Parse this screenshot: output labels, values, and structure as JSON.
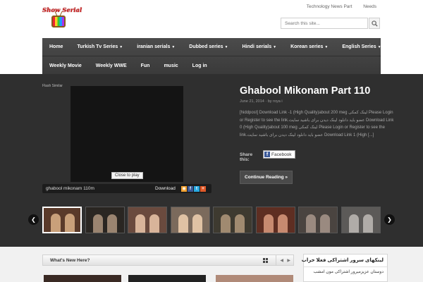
{
  "header": {
    "logo_text": "Show Serial",
    "top_links": [
      "Technology News Part",
      "Needs"
    ],
    "search_placeholder": "Search this site..."
  },
  "nav": {
    "row1": [
      {
        "label": "Home",
        "dropdown": false
      },
      {
        "label": "Turkish Tv Series",
        "dropdown": true
      },
      {
        "label": "iranian serials",
        "dropdown": true
      },
      {
        "label": "Dubbed series",
        "dropdown": true
      },
      {
        "label": "Hindi serials",
        "dropdown": true
      },
      {
        "label": "Korean series",
        "dropdown": true
      },
      {
        "label": "English Series",
        "dropdown": true
      }
    ],
    "row2": [
      {
        "label": "Weekly Movie",
        "dropdown": false
      },
      {
        "label": "Weekly WWE",
        "dropdown": false
      },
      {
        "label": "Fun",
        "dropdown": false
      },
      {
        "label": "music",
        "dropdown": false
      },
      {
        "label": "Log in",
        "dropdown": false
      }
    ]
  },
  "featured": {
    "video_top_label": "Flash Similar",
    "close_button": "Close to play",
    "video_title": "ghabool mikonam 110m",
    "download_label": "Download",
    "title": "Ghabool Mikonam Part 110",
    "meta": "June 21, 2014 · by roya i",
    "excerpt": "[hiddpost] Download Link -1 (High Quality)about 200 meg لینک کمکی Please Login or Register to see the link.عضو باید دانلود لینک دیدن برای باشید سایت Download Link 0 (High Quality)about 100 meg لینک کمکی Please Login or Register to see the link.عضو باید دانلود لینک دیدن برای باشید سایت Download Link 1 (High [...]",
    "share_label": "Share this:",
    "facebook_label": "Facebook",
    "continue_label": "Continue Reading »"
  },
  "carousel": {
    "prev_icon": "chevron-left-icon",
    "next_icon": "chevron-right-icon",
    "thumbnails": [
      {
        "bg": "#5a3a2a",
        "fig": "#c9a07a",
        "active": true
      },
      {
        "bg": "#2a2622",
        "fig": "#9a8470",
        "active": false
      },
      {
        "bg": "#6a4a3e",
        "fig": "#d8b49a",
        "active": false
      },
      {
        "bg": "#7b6a5c",
        "fig": "#e0c2a4",
        "active": false
      },
      {
        "bg": "#3e3a30",
        "fig": "#a08a70",
        "active": false
      },
      {
        "bg": "#5e2e22",
        "fig": "#c78a70",
        "active": false
      },
      {
        "bg": "#4a4440",
        "fig": "#9a8a80",
        "active": false
      },
      {
        "bg": "#5c5a58",
        "fig": "#b0aca8",
        "active": false
      }
    ]
  },
  "bottom": {
    "whats_new": "What's New Here?",
    "sidebar_title": "لینکهای سرور اشتراکی فعلا خراب",
    "sidebar_text": "دوستان عزیزمیرور اشتراکی مون امشب"
  },
  "colors": {
    "nav_bg": "#444444",
    "featured_bg": "#2f2f2f",
    "facebook": "#3b5998",
    "logo_red": "#cc1f1f"
  }
}
